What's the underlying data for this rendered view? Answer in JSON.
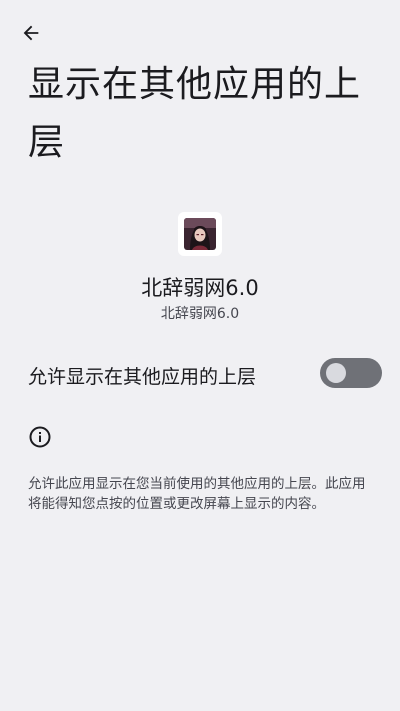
{
  "header": {
    "back_icon": "arrow-left-icon"
  },
  "page": {
    "title": "显示在其他应用的上层"
  },
  "app": {
    "icon": "app-avatar-icon",
    "name": "北辞弱网6.0",
    "subtitle": "北辞弱网6.0"
  },
  "permission": {
    "label": "允许显示在其他应用的上层",
    "enabled": false
  },
  "info": {
    "icon": "info-icon",
    "description": "允许此应用显示在您当前使用的其他应用的上层。此应用将能得知您点按的位置或更改屏幕上显示的内容。"
  },
  "colors": {
    "background": "#f0f0f3",
    "switch_track_off": "#6f7177",
    "switch_thumb_off": "#d9dadf"
  }
}
